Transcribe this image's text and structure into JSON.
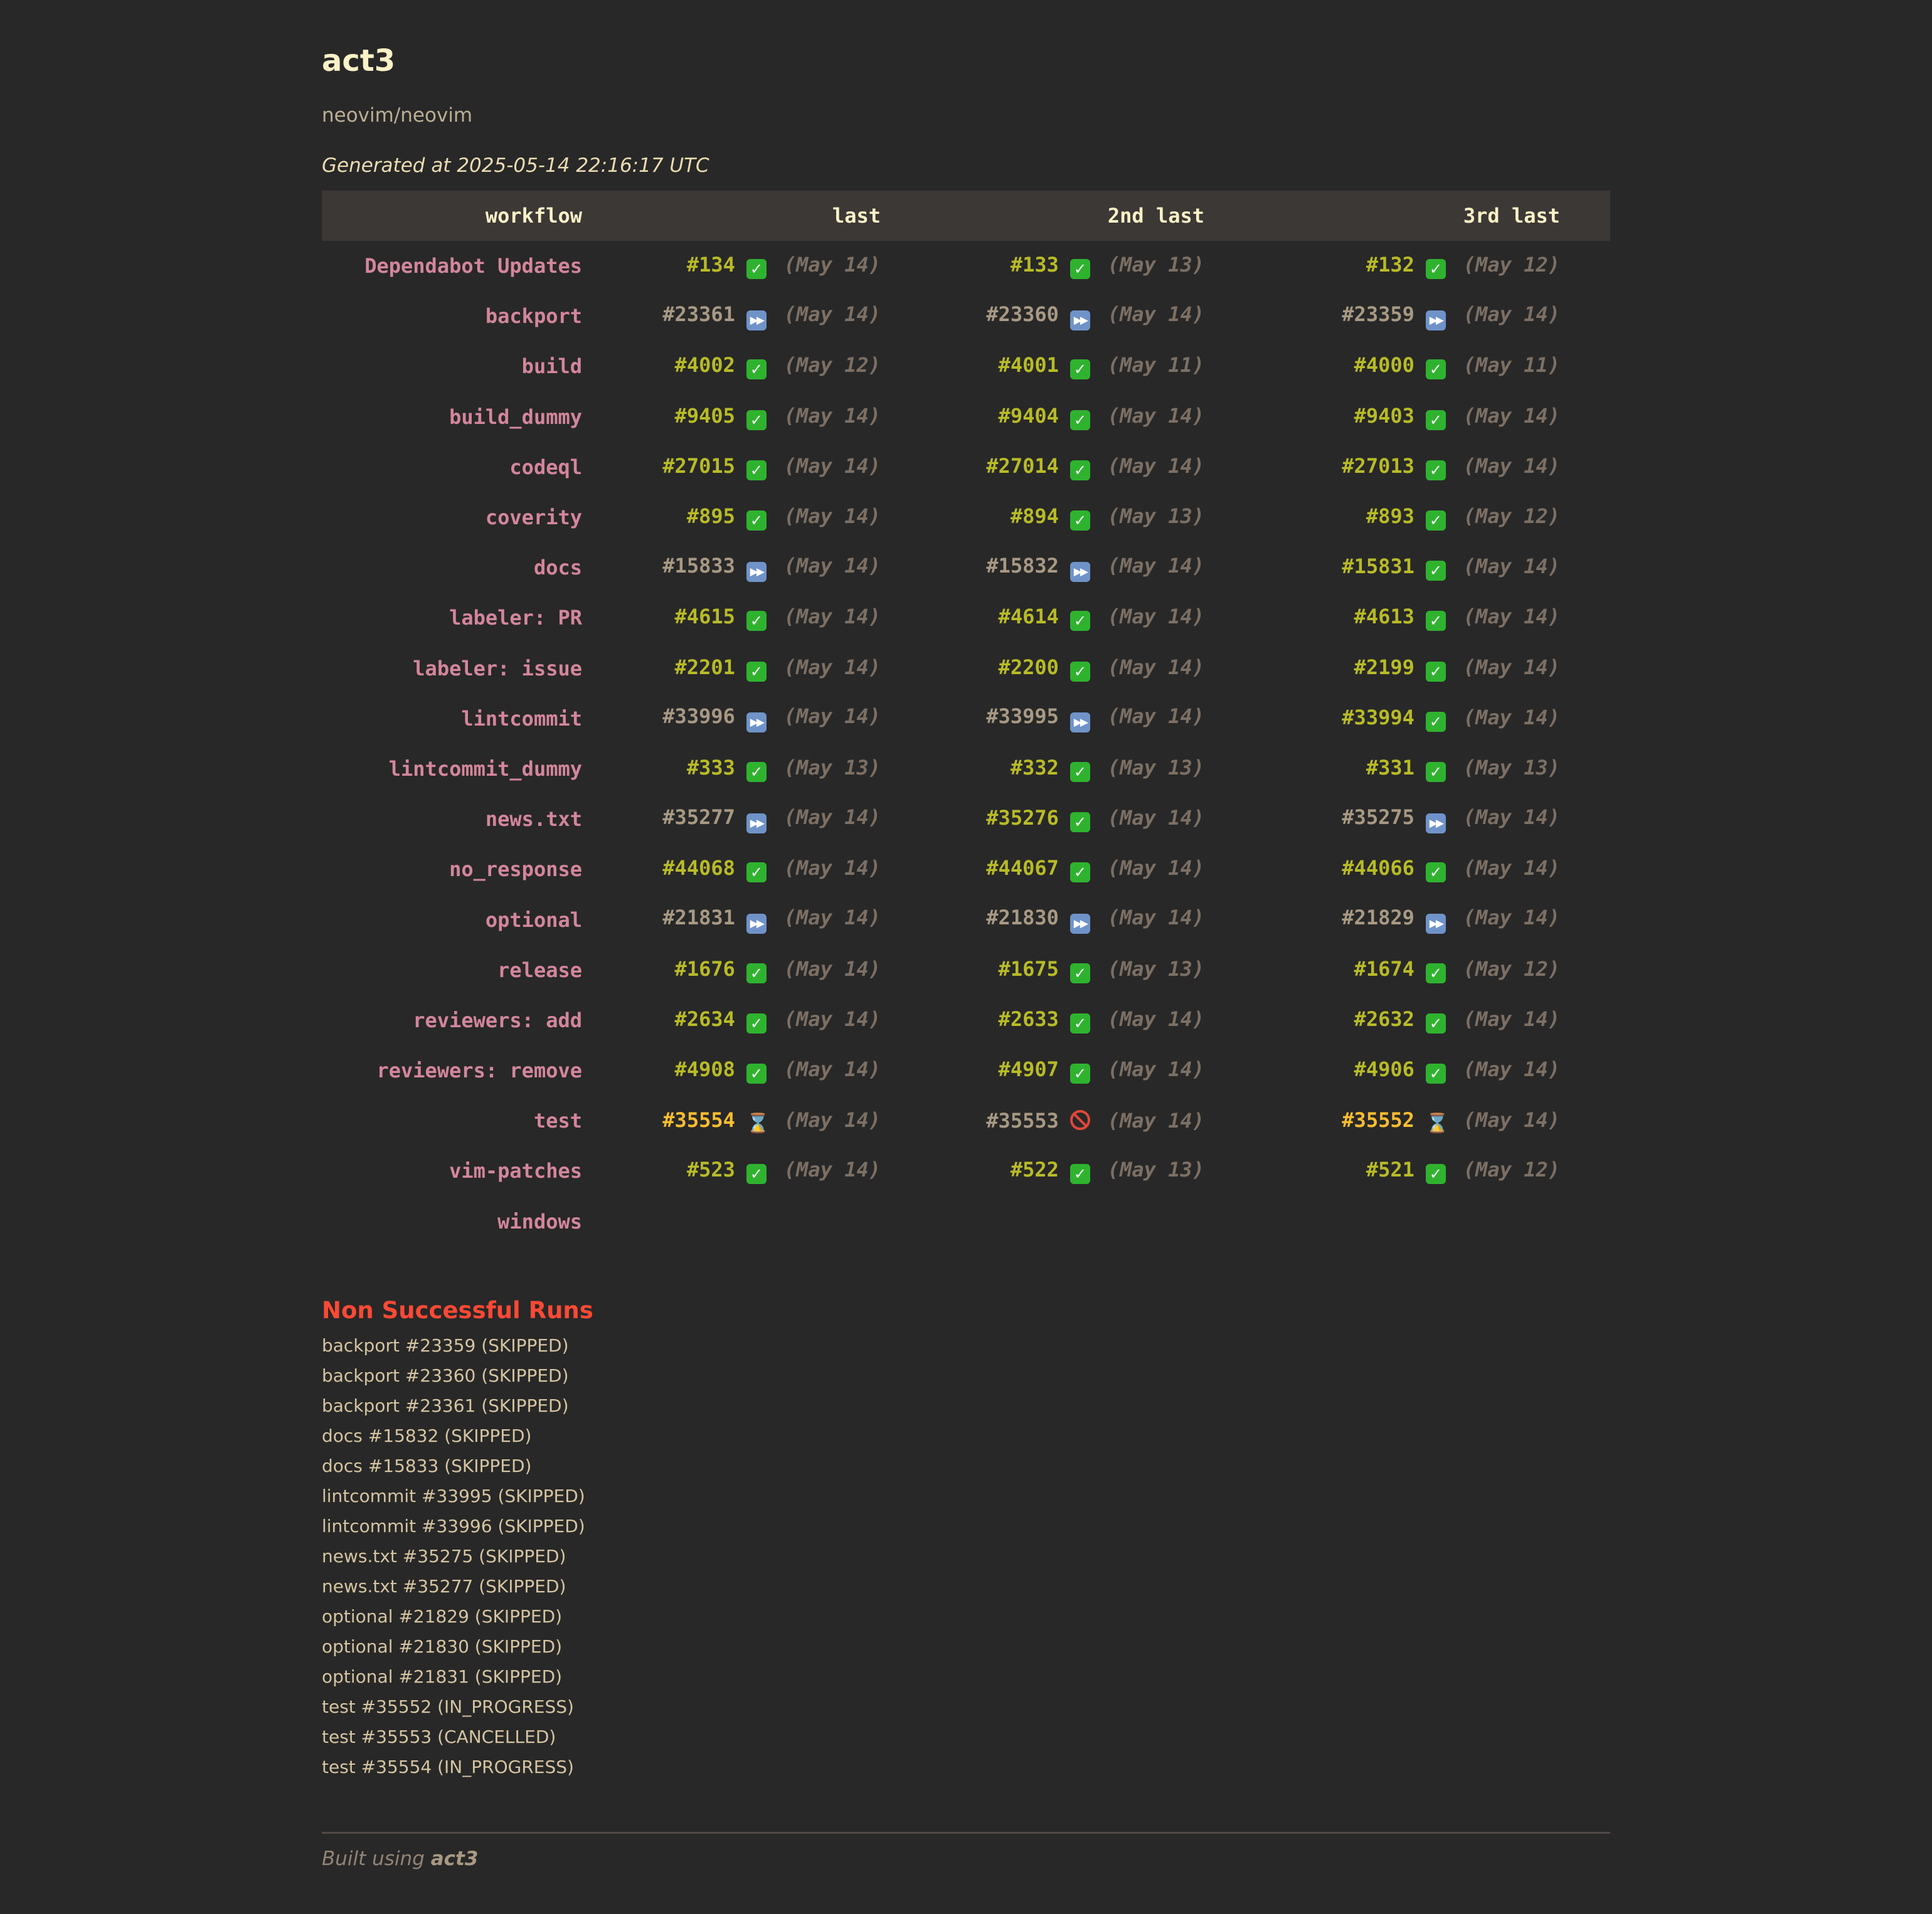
{
  "header": {
    "title": "act3",
    "repo": "neovim/neovim",
    "generated": "Generated at 2025-05-14 22:16:17 UTC"
  },
  "table": {
    "columns": [
      "workflow",
      "last",
      "2nd last",
      "3rd last"
    ],
    "rows": [
      {
        "workflow": "Dependabot Updates",
        "runs": [
          {
            "num": "#134",
            "status": "success",
            "date": "(May 14)"
          },
          {
            "num": "#133",
            "status": "success",
            "date": "(May 13)"
          },
          {
            "num": "#132",
            "status": "success",
            "date": "(May 12)"
          }
        ]
      },
      {
        "workflow": "backport",
        "runs": [
          {
            "num": "#23361",
            "status": "skipped",
            "date": "(May 14)"
          },
          {
            "num": "#23360",
            "status": "skipped",
            "date": "(May 14)"
          },
          {
            "num": "#23359",
            "status": "skipped",
            "date": "(May 14)"
          }
        ]
      },
      {
        "workflow": "build",
        "runs": [
          {
            "num": "#4002",
            "status": "success",
            "date": "(May 12)"
          },
          {
            "num": "#4001",
            "status": "success",
            "date": "(May 11)"
          },
          {
            "num": "#4000",
            "status": "success",
            "date": "(May 11)"
          }
        ]
      },
      {
        "workflow": "build_dummy",
        "runs": [
          {
            "num": "#9405",
            "status": "success",
            "date": "(May 14)"
          },
          {
            "num": "#9404",
            "status": "success",
            "date": "(May 14)"
          },
          {
            "num": "#9403",
            "status": "success",
            "date": "(May 14)"
          }
        ]
      },
      {
        "workflow": "codeql",
        "runs": [
          {
            "num": "#27015",
            "status": "success",
            "date": "(May 14)"
          },
          {
            "num": "#27014",
            "status": "success",
            "date": "(May 14)"
          },
          {
            "num": "#27013",
            "status": "success",
            "date": "(May 14)"
          }
        ]
      },
      {
        "workflow": "coverity",
        "runs": [
          {
            "num": "#895",
            "status": "success",
            "date": "(May 14)"
          },
          {
            "num": "#894",
            "status": "success",
            "date": "(May 13)"
          },
          {
            "num": "#893",
            "status": "success",
            "date": "(May 12)"
          }
        ]
      },
      {
        "workflow": "docs",
        "runs": [
          {
            "num": "#15833",
            "status": "skipped",
            "date": "(May 14)"
          },
          {
            "num": "#15832",
            "status": "skipped",
            "date": "(May 14)"
          },
          {
            "num": "#15831",
            "status": "success",
            "date": "(May 14)"
          }
        ]
      },
      {
        "workflow": "labeler: PR",
        "runs": [
          {
            "num": "#4615",
            "status": "success",
            "date": "(May 14)"
          },
          {
            "num": "#4614",
            "status": "success",
            "date": "(May 14)"
          },
          {
            "num": "#4613",
            "status": "success",
            "date": "(May 14)"
          }
        ]
      },
      {
        "workflow": "labeler: issue",
        "runs": [
          {
            "num": "#2201",
            "status": "success",
            "date": "(May 14)"
          },
          {
            "num": "#2200",
            "status": "success",
            "date": "(May 14)"
          },
          {
            "num": "#2199",
            "status": "success",
            "date": "(May 14)"
          }
        ]
      },
      {
        "workflow": "lintcommit",
        "runs": [
          {
            "num": "#33996",
            "status": "skipped",
            "date": "(May 14)"
          },
          {
            "num": "#33995",
            "status": "skipped",
            "date": "(May 14)"
          },
          {
            "num": "#33994",
            "status": "success",
            "date": "(May 14)"
          }
        ]
      },
      {
        "workflow": "lintcommit_dummy",
        "runs": [
          {
            "num": "#333",
            "status": "success",
            "date": "(May 13)"
          },
          {
            "num": "#332",
            "status": "success",
            "date": "(May 13)"
          },
          {
            "num": "#331",
            "status": "success",
            "date": "(May 13)"
          }
        ]
      },
      {
        "workflow": "news.txt",
        "runs": [
          {
            "num": "#35277",
            "status": "skipped",
            "date": "(May 14)"
          },
          {
            "num": "#35276",
            "status": "success",
            "date": "(May 14)"
          },
          {
            "num": "#35275",
            "status": "skipped",
            "date": "(May 14)"
          }
        ]
      },
      {
        "workflow": "no_response",
        "runs": [
          {
            "num": "#44068",
            "status": "success",
            "date": "(May 14)"
          },
          {
            "num": "#44067",
            "status": "success",
            "date": "(May 14)"
          },
          {
            "num": "#44066",
            "status": "success",
            "date": "(May 14)"
          }
        ]
      },
      {
        "workflow": "optional",
        "runs": [
          {
            "num": "#21831",
            "status": "skipped",
            "date": "(May 14)"
          },
          {
            "num": "#21830",
            "status": "skipped",
            "date": "(May 14)"
          },
          {
            "num": "#21829",
            "status": "skipped",
            "date": "(May 14)"
          }
        ]
      },
      {
        "workflow": "release",
        "runs": [
          {
            "num": "#1676",
            "status": "success",
            "date": "(May 14)"
          },
          {
            "num": "#1675",
            "status": "success",
            "date": "(May 13)"
          },
          {
            "num": "#1674",
            "status": "success",
            "date": "(May 12)"
          }
        ]
      },
      {
        "workflow": "reviewers: add",
        "runs": [
          {
            "num": "#2634",
            "status": "success",
            "date": "(May 14)"
          },
          {
            "num": "#2633",
            "status": "success",
            "date": "(May 14)"
          },
          {
            "num": "#2632",
            "status": "success",
            "date": "(May 14)"
          }
        ]
      },
      {
        "workflow": "reviewers: remove",
        "runs": [
          {
            "num": "#4908",
            "status": "success",
            "date": "(May 14)"
          },
          {
            "num": "#4907",
            "status": "success",
            "date": "(May 14)"
          },
          {
            "num": "#4906",
            "status": "success",
            "date": "(May 14)"
          }
        ]
      },
      {
        "workflow": "test",
        "runs": [
          {
            "num": "#35554",
            "status": "in_progress",
            "date": "(May 14)"
          },
          {
            "num": "#35553",
            "status": "cancelled",
            "date": "(May 14)"
          },
          {
            "num": "#35552",
            "status": "in_progress",
            "date": "(May 14)"
          }
        ]
      },
      {
        "workflow": "vim-patches",
        "runs": [
          {
            "num": "#523",
            "status": "success",
            "date": "(May 14)"
          },
          {
            "num": "#522",
            "status": "success",
            "date": "(May 13)"
          },
          {
            "num": "#521",
            "status": "success",
            "date": "(May 12)"
          }
        ]
      },
      {
        "workflow": "windows",
        "runs": []
      }
    ]
  },
  "status_icons": {
    "success": "check-mark-icon",
    "skipped": "fast-forward-icon",
    "in_progress": "hourglass-icon",
    "cancelled": "prohibited-icon"
  },
  "non_successful": {
    "title": "Non Successful Runs",
    "items": [
      "backport #23359 (SKIPPED)",
      "backport #23360 (SKIPPED)",
      "backport #23361 (SKIPPED)",
      "docs #15832 (SKIPPED)",
      "docs #15833 (SKIPPED)",
      "lintcommit #33995 (SKIPPED)",
      "lintcommit #33996 (SKIPPED)",
      "news.txt #35275 (SKIPPED)",
      "news.txt #35277 (SKIPPED)",
      "optional #21829 (SKIPPED)",
      "optional #21830 (SKIPPED)",
      "optional #21831 (SKIPPED)",
      "test #35552 (IN_PROGRESS)",
      "test #35553 (CANCELLED)",
      "test #35554 (IN_PROGRESS)"
    ]
  },
  "footer": {
    "prefix": "Built using ",
    "link": "act3"
  },
  "colors": {
    "background": "#282828",
    "header_row": "#3c3836",
    "workflow": "#d3869b",
    "success_run": "#b8bb26",
    "skipped_run": "#a89984",
    "in_progress_run": "#fabd2f",
    "date": "#7c6f64",
    "error_title": "#fb4934"
  }
}
